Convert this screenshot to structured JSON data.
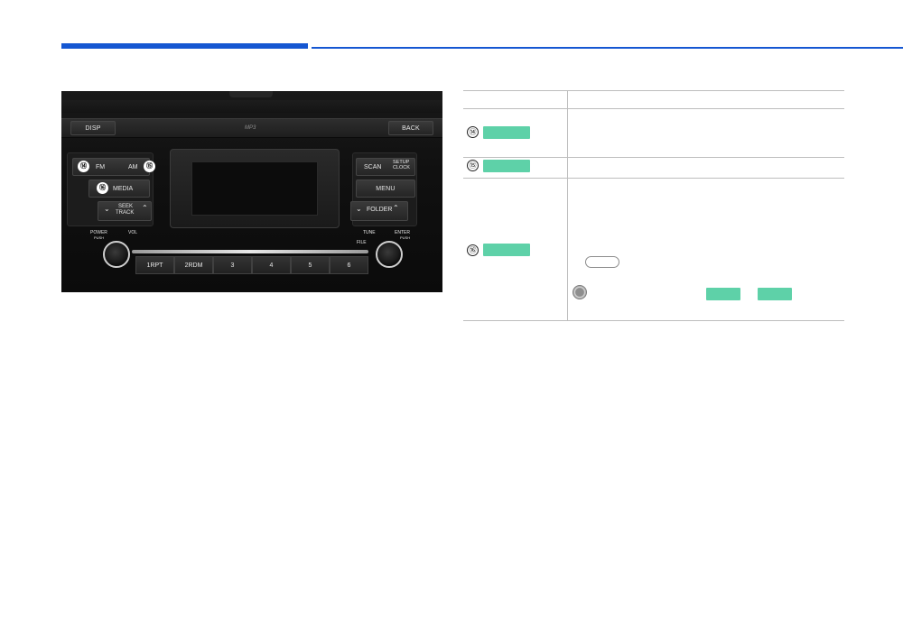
{
  "panel": {
    "disp": "DISP",
    "back": "BACK",
    "mp3": "MP3",
    "fm": "FM",
    "am": "AM",
    "media": "MEDIA",
    "seek": "SEEK",
    "track": "TRACK",
    "scan": "SCAN",
    "setup": "SETUP",
    "clock": "CLOCK",
    "menu": "MENU",
    "folder": "FOLDER",
    "power": "POWER",
    "push": "PUSH",
    "vol": "VOL",
    "tune": "TUNE",
    "file": "FILE",
    "enter": "ENTER",
    "presets": [
      "1RPT",
      "2RDM",
      "3",
      "4",
      "5",
      "6"
    ],
    "callouts": [
      "⑭",
      "⑮",
      "⑯"
    ]
  },
  "table": {
    "row_numbers": [
      "⑭",
      "⑮",
      "⑯"
    ]
  },
  "colors": {
    "brand_blue": "#1557d2",
    "tag_green": "#5ed1a8"
  },
  "icons": [
    "info-icon"
  ]
}
